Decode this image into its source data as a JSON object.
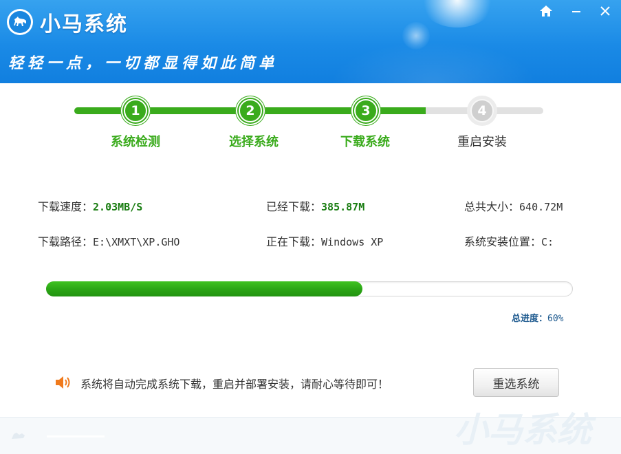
{
  "window": {
    "app_title": "小马系统",
    "slogan": "轻轻一点，一切都显得如此简单",
    "home_icon": "home-icon",
    "minimize_icon": "minimize-icon",
    "close_icon": "close-icon"
  },
  "colors": {
    "header_blue": "#1a8ae6",
    "accent_green": "#3aab1c",
    "inactive_gray": "#cfcfcf",
    "progress_label_blue": "#1e5a8f"
  },
  "steps": [
    {
      "number": "1",
      "label": "系统检测",
      "state": "done"
    },
    {
      "number": "2",
      "label": "选择系统",
      "state": "done"
    },
    {
      "number": "3",
      "label": "下载系统",
      "state": "done"
    },
    {
      "number": "4",
      "label": "重启安装",
      "state": "todo"
    }
  ],
  "info": {
    "speed_label": "下载速度：",
    "speed_value": "2.03MB/S",
    "downloaded_label": "已经下载：",
    "downloaded_value": "385.87M",
    "total_label": "总共大小：",
    "total_value": "640.72M",
    "path_label": "下载路径：",
    "path_value": "E:\\XMXT\\XP.GHO",
    "current_label": "正在下载：",
    "current_value": "Windows XP",
    "install_loc_label": "系统安装位置：",
    "install_loc_value": "C:"
  },
  "progress": {
    "label": "总进度：",
    "value_text": "60%",
    "fraction": 0.6
  },
  "notice": {
    "icon": "speaker-icon",
    "text": "系统将自动完成系统下载，重启并部署安装，请耐心等待即可！"
  },
  "actions": {
    "reselect_label": "重选系统"
  },
  "watermark": {
    "text": "小马系统"
  }
}
